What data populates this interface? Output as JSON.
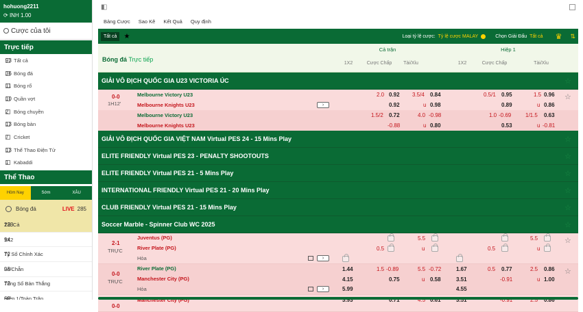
{
  "user": {
    "name": "hohuong2211",
    "balance": "INH 1.00"
  },
  "sidebar": {
    "my_bets": "Cược của tôi",
    "live_title": "Trực tiếp",
    "live_items": [
      {
        "label": "Tất cả",
        "count": "93"
      },
      {
        "label": "Bóng đá",
        "count": "36"
      },
      {
        "label": "Bóng rổ",
        "count": "11"
      },
      {
        "label": "Quần vợt",
        "count": "10"
      },
      {
        "label": "Bóng chuyền",
        "count": "2"
      },
      {
        "label": "Bóng bàn",
        "count": "13"
      },
      {
        "label": "Cricket",
        "count": "7"
      },
      {
        "label": "Thể Thao Điện Tử",
        "count": "13"
      },
      {
        "label": "Kabaddi",
        "count": "1"
      }
    ],
    "sports_title": "Thể Thao",
    "filter_tabs": [
      "Hôm Nay",
      "Sớm",
      "XÂU"
    ],
    "sport_item": {
      "label": "Bóng đá",
      "live": "LIVE",
      "count": "285"
    },
    "sub_items": [
      {
        "label": "Tất Cả",
        "count": "223"
      },
      {
        "label": "1X2",
        "count": "94"
      },
      {
        "label": "Tỷ Số Chính Xác",
        "count": "72"
      },
      {
        "label": "Lẻ/Chẵn",
        "count": "93"
      },
      {
        "label": "Tổng Số Bàn Thắng",
        "count": "72"
      },
      {
        "label": "Hiệp 1/Toàn Trận",
        "count": "68"
      }
    ]
  },
  "nav": [
    "Bảng Cược",
    "Sao Kê",
    "Kết Quả",
    "Quy định"
  ],
  "toolbar": {
    "all": "Tất cả",
    "odds_label": "Loại tỷ lệ cược:",
    "odds_value": "Tỷ lệ cược MALAY",
    "league_label": "Chọn Giải Đấu",
    "league_value": "Tất cả"
  },
  "header": {
    "sport": "Bóng đá",
    "live": "Trực tiếp",
    "full": "Cả trận",
    "half": "Hiệp 1",
    "cols": [
      "1X2",
      "Cược Chấp",
      "Tài/Xỉu",
      "1X2",
      "Cược Chấp",
      "Tài/Xỉu"
    ]
  },
  "league1": {
    "name": "GIẢI VÔ ĐỊCH QUỐC GIA U23 VICTORIA ÚC",
    "score": "0-0",
    "time": "1H12'",
    "home": "Melbourne Victory U23",
    "away": "Melbourne Knights U23",
    "r1": {
      "h1": "2.0",
      "h2": "0.92",
      "o1": "3.5/4",
      "o2": "0.84",
      "hh1": "0.5/1",
      "hh2": "0.95",
      "ho1": "1.5",
      "ho2": "0.96"
    },
    "r2": {
      "h2": "0.92",
      "o1": "u",
      "o2": "0.98",
      "hh2": "0.89",
      "ho1": "u",
      "ho2": "0.86"
    },
    "r3": {
      "h1": "1.5/2",
      "h2": "0.72",
      "o1": "4.0",
      "o2": "-0.98",
      "hh1": "1.0",
      "hh2": "-0.69",
      "ho1": "1/1.5",
      "ho2": "0.63"
    },
    "r4": {
      "h2": "-0.88",
      "o1": "u",
      "o2": "0.80",
      "hh2": "0.53",
      "ho1": "u",
      "ho2": "-0.81"
    }
  },
  "leagues": [
    "GIẢI VÔ ĐỊCH QUỐC GIA VIỆT NAM Virtual PES 24 - 15 Mins Play",
    "ELITE FRIENDLY Virtual PES 23 - PENALTY SHOOTOUTS",
    "ELITE FRIENDLY Virtual PES 21 - 5 Mins Play",
    "INTERNATIONAL FRIENDLY Virtual PES 21 - 20 Mins Play",
    "CLUB FRIENDLY Virtual PES 21 - 15 Mins Play",
    "Soccer Marble - Spinner Club WC 2025"
  ],
  "m1": {
    "score": "2-1",
    "status": "TRỰC",
    "home": "Juventus (PG)",
    "away": "River Plate (PG)",
    "draw": "Hòa",
    "o1": "5.5",
    "h2": "0.5",
    "o2": "u",
    "hh": "0.5",
    "ho1": "5.5",
    "ho2": "u"
  },
  "m2": {
    "score": "0-0",
    "status": "TRỰC",
    "home": "River Plate (PG)",
    "away": "Manchester City (PG)",
    "draw": "Hòa",
    "a": {
      "x1": "1.44",
      "h1": "1.5",
      "h2": "-0.89",
      "o1": "5.5",
      "o2": "-0.72",
      "f1": "1.67",
      "hh1": "0.5",
      "hh2": "0.77",
      "ho1": "2.5",
      "ho2": "0.86"
    },
    "b": {
      "x1": "4.15",
      "h2": "0.75",
      "o1": "u",
      "o2": "0.58",
      "f1": "3.51",
      "hh2": "-0.91",
      "ho1": "u",
      "ho2": "1.00"
    },
    "c": {
      "x1": "5.99",
      "f1": "4.55"
    }
  },
  "m3": {
    "score": "0-0",
    "home": "Manchester City (PG)",
    "x1": "3.93",
    "h2": "0.71",
    "o1": "4.5",
    "o2": "0.61",
    "f1": "3.51",
    "hh2": "-0.91",
    "ho1": "2.5",
    "ho2": "0.86"
  }
}
